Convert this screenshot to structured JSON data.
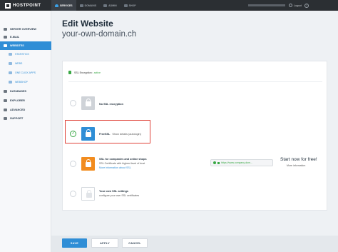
{
  "app": {
    "logo_text": "HOSTPOINT"
  },
  "topnav": [
    {
      "label": "SERVICES",
      "active": true
    },
    {
      "label": "DOMAINS",
      "active": false
    },
    {
      "label": "ADMIN",
      "active": false
    },
    {
      "label": "SHOP",
      "active": false
    }
  ],
  "user": {
    "logout_label": "Logout",
    "help_glyph": "?"
  },
  "sidebar": {
    "items": [
      {
        "label": "SERVER OVERVIEW"
      },
      {
        "label": "E-MAIL"
      },
      {
        "label": "WEBSITES",
        "active": true
      },
      {
        "label": "DATABASES"
      },
      {
        "label": "EXPLORER"
      },
      {
        "label": "ADVANCED"
      },
      {
        "label": "SUPPORT"
      }
    ],
    "subitems": [
      {
        "label": "STATISTICS"
      },
      {
        "label": "WEBS"
      },
      {
        "label": "ONE CLICK APPS"
      },
      {
        "label": "WEBSHOP"
      }
    ]
  },
  "page": {
    "title": "Edit Website",
    "subtitle": "your-own-domain.ch"
  },
  "ssl": {
    "status_label": "SSL Encryption:",
    "status_value": "active",
    "options": [
      {
        "title": "No SSL encryption",
        "selected": false
      },
      {
        "title": "FreeSSL",
        "inline_link": "Show details (autologin)",
        "selected": true
      },
      {
        "title": "SSL for companies and online shops",
        "desc": "SSL Certificate with highest level of trust",
        "link": "More information about SSL",
        "selected": false
      },
      {
        "title": "Your own SSL settings",
        "desc": "configure your own SSL certificates",
        "selected": false
      }
    ]
  },
  "promo": {
    "url_text": "https://www.company-dom...",
    "title": "Start now for free!",
    "subtitle": "More information"
  },
  "buttons": {
    "save": "SAVE",
    "apply": "APPLY",
    "cancel": "CANCEL"
  },
  "colors": {
    "accent": "#2f8ed6",
    "success": "#3aa845",
    "orange": "#f28c1f",
    "highlight": "#e0443a"
  }
}
